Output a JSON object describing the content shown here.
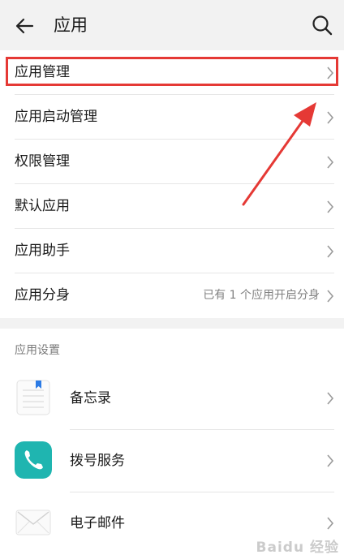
{
  "header": {
    "title": "应用",
    "back_icon": "arrow-left-icon",
    "search_icon": "search-icon"
  },
  "menu": [
    {
      "label": "应用管理",
      "value": "",
      "highlighted": true
    },
    {
      "label": "应用启动管理",
      "value": ""
    },
    {
      "label": "权限管理",
      "value": ""
    },
    {
      "label": "默认应用",
      "value": ""
    },
    {
      "label": "应用助手",
      "value": ""
    },
    {
      "label": "应用分身",
      "value": "已有 1 个应用开启分身"
    }
  ],
  "settings": {
    "section_title": "应用设置",
    "apps": [
      {
        "label": "备忘录",
        "icon": "notepad-icon"
      },
      {
        "label": "拨号服务",
        "icon": "phone-icon"
      },
      {
        "label": "电子邮件",
        "icon": "envelope-icon"
      }
    ]
  },
  "colors": {
    "highlight": "#e53935",
    "phone_app": "#1fb5b0",
    "background": "#f2f2f2"
  },
  "watermark": "Baidu 经验"
}
